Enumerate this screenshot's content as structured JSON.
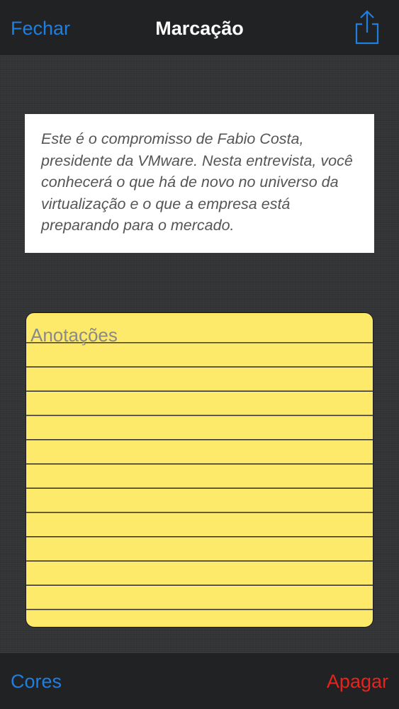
{
  "navbar": {
    "close_label": "Fechar",
    "title": "Marcação",
    "share_icon": "share-icon"
  },
  "quote": {
    "text": "Este é o compromisso de Fabio Costa, presidente da VMware. Nesta entrevista, você conhecerá o que há de novo no universo da virtualização e o que a empresa está preparando para o mercado."
  },
  "notes": {
    "placeholder": "Anotações",
    "value": "",
    "background_color": "#fde96a"
  },
  "toolbar": {
    "colors_label": "Cores",
    "delete_label": "Apagar"
  },
  "colors": {
    "accent": "#1f7fe0",
    "destructive": "#e5241d",
    "bar_background": "#212224",
    "page_background": "#333436"
  }
}
